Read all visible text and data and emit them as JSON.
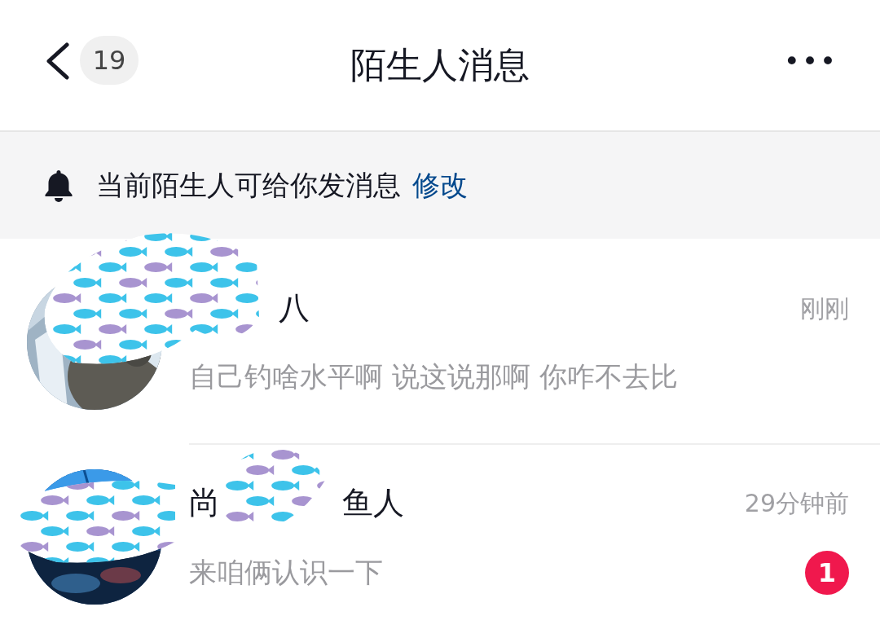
{
  "header": {
    "back_count": "19",
    "title": "陌生人消息",
    "more": "•••"
  },
  "notice": {
    "text": "当前陌生人可给你发消息",
    "action": "修改"
  },
  "conversations": [
    {
      "name_parts": [
        "八"
      ],
      "time": "刚刚",
      "preview": "自己钓啥水平啊 说这说那啊 你咋不去比"
    },
    {
      "name_parts": [
        "尚",
        "鱼人"
      ],
      "time": "29分钟前",
      "preview": "来咱俩认识一下",
      "unread": "1"
    }
  ]
}
